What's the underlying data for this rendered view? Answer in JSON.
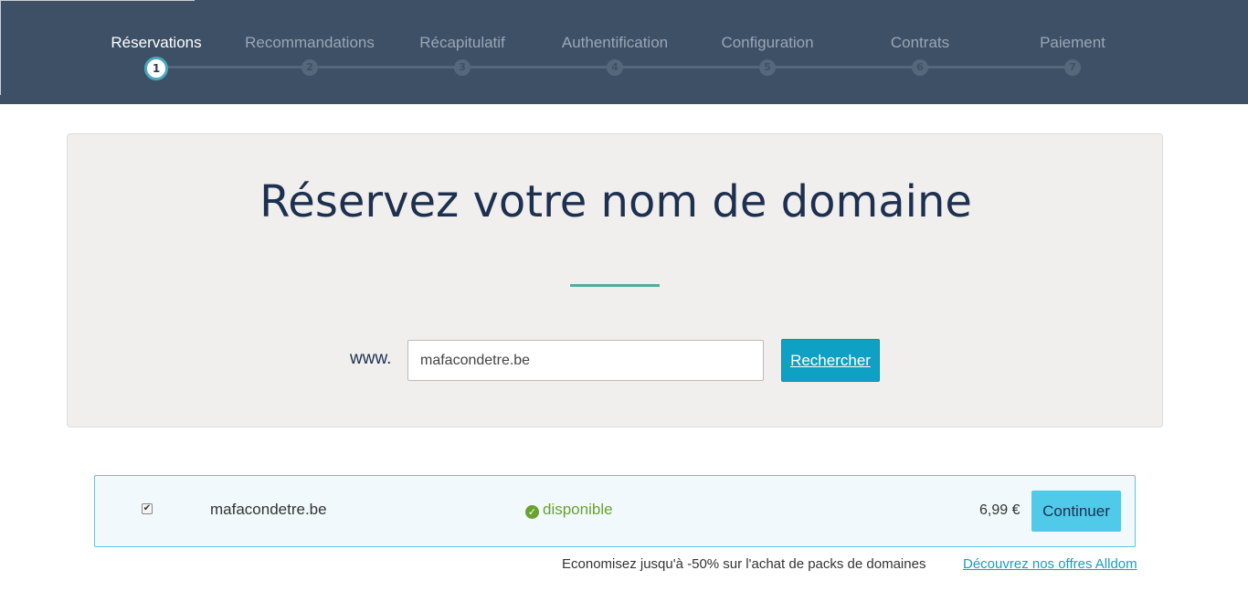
{
  "steps": [
    {
      "label": "Réservations",
      "number": "1",
      "active": true
    },
    {
      "label": "Recommandations",
      "number": "2",
      "active": false
    },
    {
      "label": "Récapitulatif",
      "number": "3",
      "active": false
    },
    {
      "label": "Authentification",
      "number": "4",
      "active": false
    },
    {
      "label": "Configuration",
      "number": "5",
      "active": false
    },
    {
      "label": "Contrats",
      "number": "6",
      "active": false
    },
    {
      "label": "Paiement",
      "number": "7",
      "active": false
    }
  ],
  "search": {
    "title": "Réservez votre nom de domaine",
    "prefix": "www.",
    "value": "mafacondetre.be",
    "button_label": "Rechercher"
  },
  "result": {
    "checked": true,
    "domain": "mafacondetre.be",
    "status": "disponible",
    "status_icon": "check-circle-icon",
    "price": "6,99 €",
    "continue_label": "Continuer"
  },
  "promo": {
    "text": "Economisez jusqu'à -50% sur l'achat de packs de domaines",
    "link": "Découvrez nos offres Alldom"
  },
  "colors": {
    "header_bg": "#3d5066",
    "accent": "#0ea1c4",
    "available": "#6aa22e",
    "divider": "#4fae9b"
  }
}
